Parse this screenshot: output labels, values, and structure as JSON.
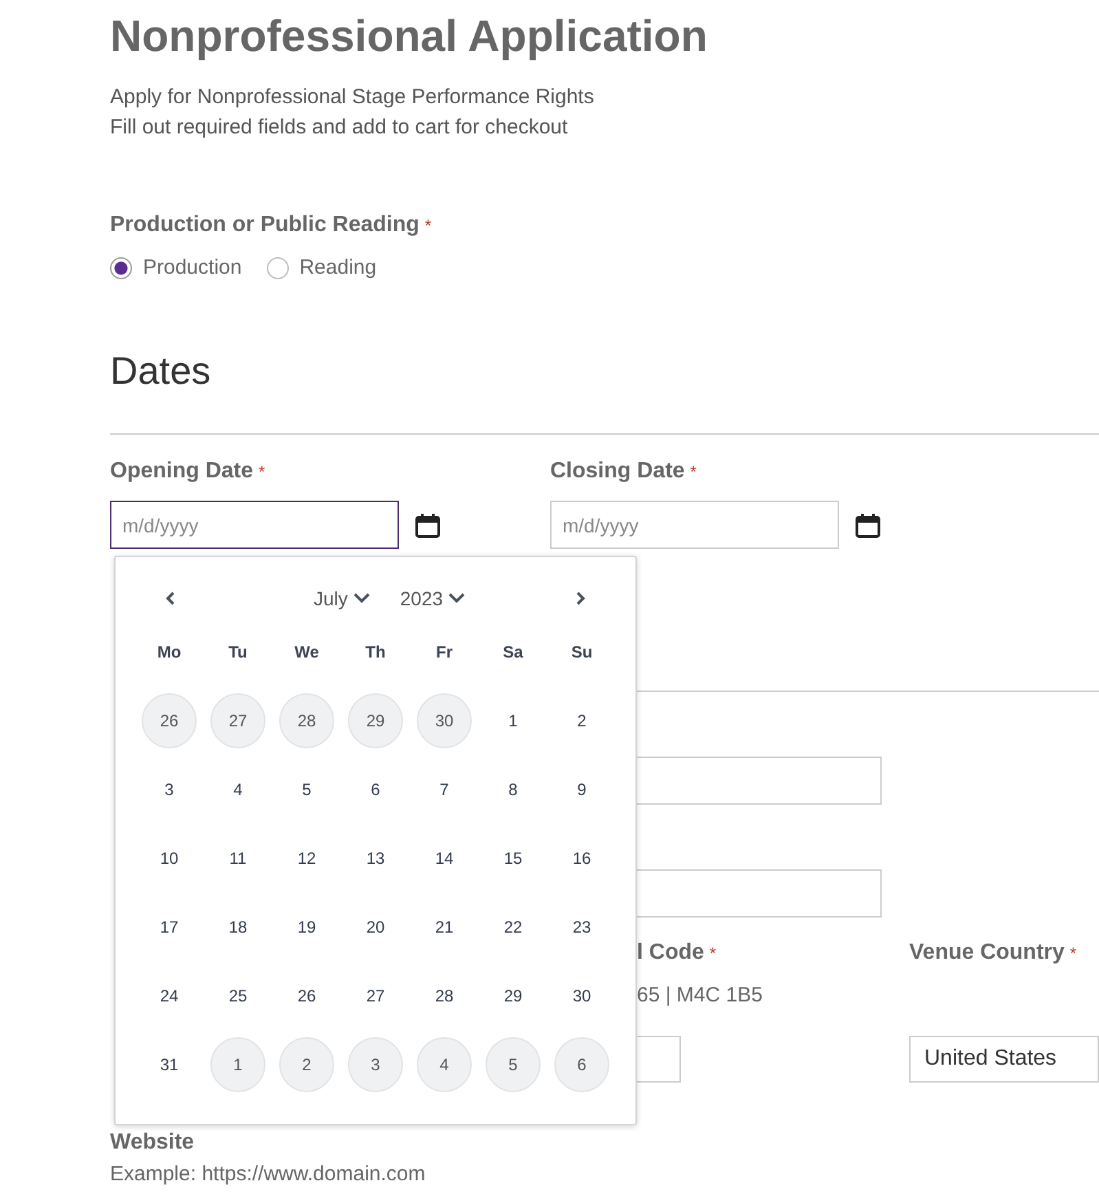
{
  "title": "Nonprofessional Application",
  "intro": [
    "Apply for Nonprofessional Stage Performance Rights",
    "Fill out required fields and add to cart for checkout"
  ],
  "production_type": {
    "label": "Production or Public Reading",
    "required_mark": "*",
    "options": [
      {
        "label": "Production",
        "selected": true
      },
      {
        "label": "Reading",
        "selected": false
      }
    ]
  },
  "dates_heading": "Dates",
  "date_fields": [
    {
      "label": "Opening Date",
      "required_mark": "*",
      "placeholder": "m/d/yyyy",
      "focused": true
    },
    {
      "label": "Closing Date",
      "required_mark": "*",
      "placeholder": "m/d/yyyy",
      "focused": false
    }
  ],
  "datepicker": {
    "month": "July",
    "year": "2023",
    "weekdays": [
      "Mo",
      "Tu",
      "We",
      "Th",
      "Fr",
      "Sa",
      "Su"
    ],
    "weeks": [
      [
        {
          "day": "26",
          "outside": true
        },
        {
          "day": "27",
          "outside": true
        },
        {
          "day": "28",
          "outside": true
        },
        {
          "day": "29",
          "outside": true
        },
        {
          "day": "30",
          "outside": true
        },
        {
          "day": "1",
          "outside": false
        },
        {
          "day": "2",
          "outside": false
        }
      ],
      [
        {
          "day": "3",
          "outside": false
        },
        {
          "day": "4",
          "outside": false
        },
        {
          "day": "5",
          "outside": false
        },
        {
          "day": "6",
          "outside": false
        },
        {
          "day": "7",
          "outside": false
        },
        {
          "day": "8",
          "outside": false
        },
        {
          "day": "9",
          "outside": false
        }
      ],
      [
        {
          "day": "10",
          "outside": false
        },
        {
          "day": "11",
          "outside": false
        },
        {
          "day": "12",
          "outside": false
        },
        {
          "day": "13",
          "outside": false
        },
        {
          "day": "14",
          "outside": false
        },
        {
          "day": "15",
          "outside": false
        },
        {
          "day": "16",
          "outside": false
        }
      ],
      [
        {
          "day": "17",
          "outside": false
        },
        {
          "day": "18",
          "outside": false
        },
        {
          "day": "19",
          "outside": false
        },
        {
          "day": "20",
          "outside": false
        },
        {
          "day": "21",
          "outside": false
        },
        {
          "day": "22",
          "outside": false
        },
        {
          "day": "23",
          "outside": false
        }
      ],
      [
        {
          "day": "24",
          "outside": false
        },
        {
          "day": "25",
          "outside": false
        },
        {
          "day": "26",
          "outside": false
        },
        {
          "day": "27",
          "outside": false
        },
        {
          "day": "28",
          "outside": false
        },
        {
          "day": "29",
          "outside": false
        },
        {
          "day": "30",
          "outside": false
        }
      ],
      [
        {
          "day": "31",
          "outside": false
        },
        {
          "day": "1",
          "outside": true
        },
        {
          "day": "2",
          "outside": true
        },
        {
          "day": "3",
          "outside": true
        },
        {
          "day": "4",
          "outside": true
        },
        {
          "day": "5",
          "outside": true
        },
        {
          "day": "6",
          "outside": true
        }
      ]
    ]
  },
  "venue": {
    "postal_label": "l Code",
    "postal_required_mark": "*",
    "postal_example": "65 | M4C 1B5",
    "country_label": "Venue Country",
    "country_required_mark": "*",
    "country_value": "United States"
  },
  "website": {
    "label": "Website",
    "example": "Example: https://www.domain.com"
  }
}
